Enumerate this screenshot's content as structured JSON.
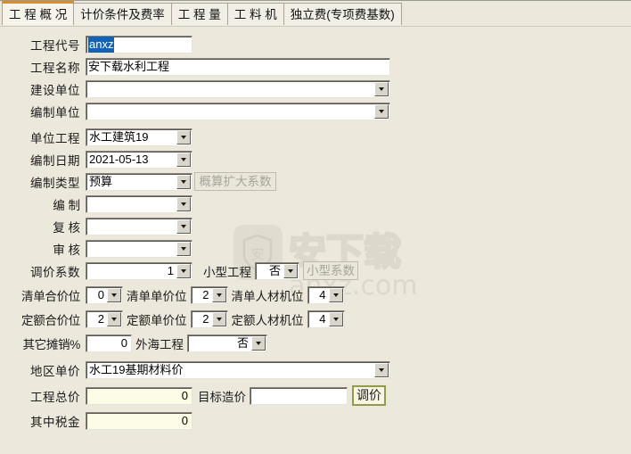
{
  "window": {
    "background_color": "#ece8dc",
    "accent_color": "#d98c2b"
  },
  "tabs": [
    {
      "label": "工 程 概 况",
      "active": true
    },
    {
      "label": "计价条件及费率",
      "active": false
    },
    {
      "label": "工    程    量",
      "active": false
    },
    {
      "label": "工    料    机",
      "active": false
    },
    {
      "label": "独立费(专项费基数)",
      "active": false
    }
  ],
  "watermark": {
    "logo_char": "安",
    "line1": "安下载",
    "line2": "anxz.com"
  },
  "form": {
    "project_code": {
      "label": "工程代号",
      "value": "anxz",
      "selected": true
    },
    "project_name": {
      "label": "工程名称",
      "value": "安下载水利工程"
    },
    "construction_unit": {
      "label": "建设单位",
      "value": ""
    },
    "compile_unit": {
      "label": "编制单位",
      "value": ""
    },
    "unit_project": {
      "label": "单位工程",
      "value": "水工建筑19"
    },
    "compile_date": {
      "label": "编制日期",
      "value": "2021-05-13"
    },
    "compile_type": {
      "label": "编制类型",
      "value": "预算"
    },
    "estimate_factor_button": {
      "label": "概算扩大系数",
      "disabled": true
    },
    "compiler": {
      "label": "编    制",
      "value": ""
    },
    "reviewer": {
      "label": "复    核",
      "value": ""
    },
    "auditor": {
      "label": "审    核",
      "value": ""
    },
    "price_adjust_factor": {
      "label": "调价系数",
      "value": "1"
    },
    "small_project": {
      "label": "小型工程",
      "value": "否"
    },
    "small_factor_button": {
      "label": "小型系数",
      "disabled": true
    },
    "list_total_digits": {
      "label": "清单合价位",
      "value": "0"
    },
    "list_unit_digits": {
      "label": "清单单价位",
      "value": "2"
    },
    "list_lmm_digits": {
      "label": "清单人材机位",
      "value": "4"
    },
    "quota_total_digits": {
      "label": "定额合价位",
      "value": "2"
    },
    "quota_unit_digits": {
      "label": "定额单价位",
      "value": "2"
    },
    "quota_lmm_digits": {
      "label": "定额人材机位",
      "value": "4"
    },
    "other_amortization": {
      "label": "其它摊销%",
      "value": "0"
    },
    "offshore_project": {
      "label": "外海工程",
      "value": "否"
    },
    "region_price": {
      "label": "地区单价",
      "value": "水工19基期材料价"
    },
    "project_total": {
      "label": "工程总价",
      "value": "0"
    },
    "target_cost": {
      "label": "目标造价",
      "value": ""
    },
    "adjust_price_button": {
      "label": "调价"
    },
    "tax_included": {
      "label": "其中税金",
      "value": "0"
    }
  }
}
